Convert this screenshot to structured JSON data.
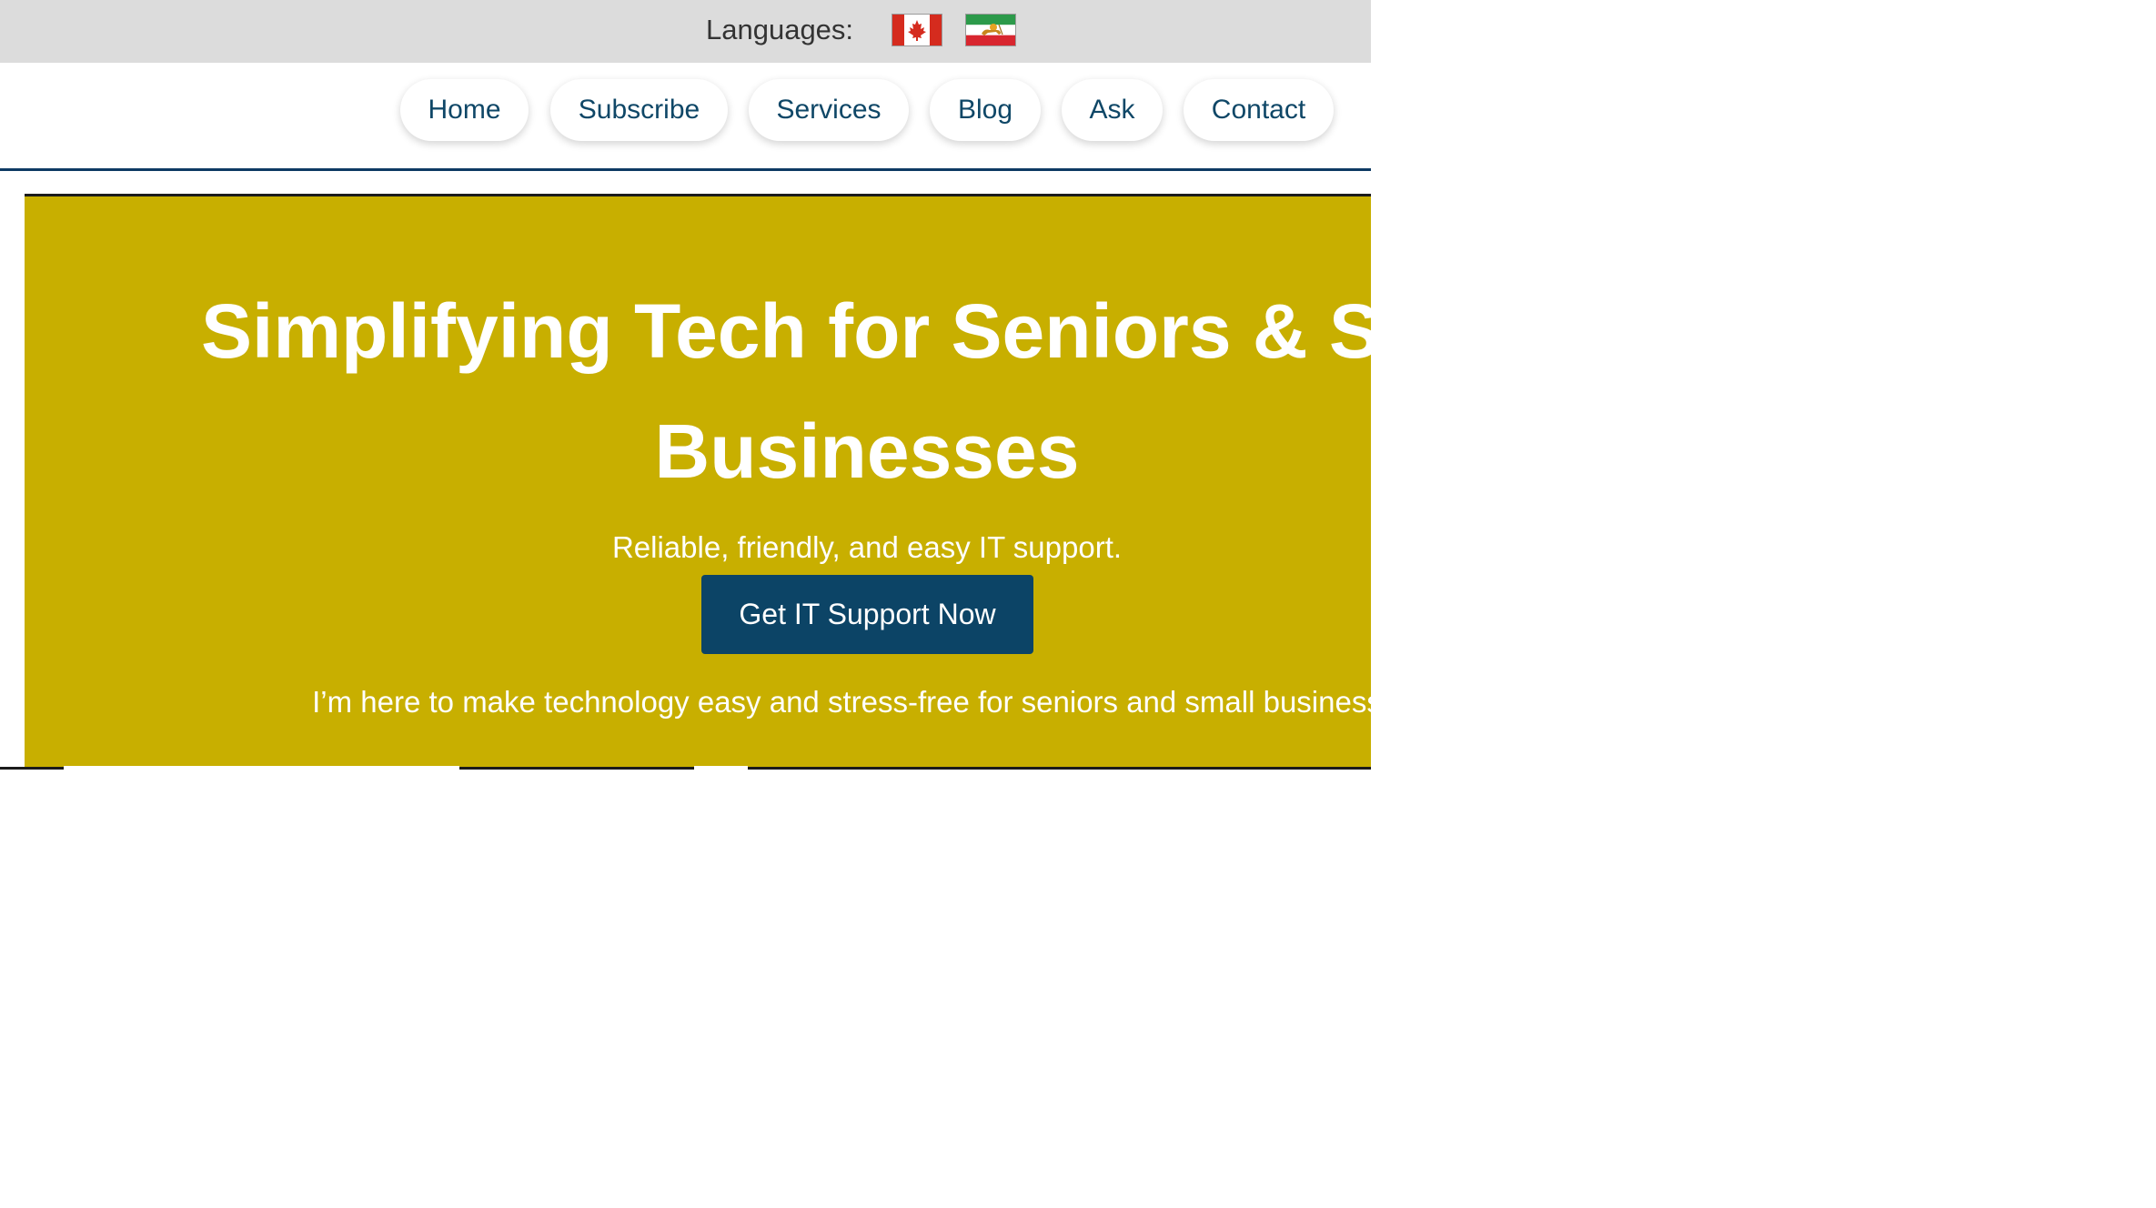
{
  "language_bar": {
    "label": "Languages:",
    "flags": [
      {
        "icon": "canada-flag-icon"
      },
      {
        "icon": "iran-lion-and-sun-flag-icon"
      }
    ]
  },
  "nav": {
    "items": [
      {
        "label": "Home"
      },
      {
        "label": "Subscribe"
      },
      {
        "label": "Services"
      },
      {
        "label": "Blog"
      },
      {
        "label": "Ask"
      },
      {
        "label": "Contact"
      }
    ]
  },
  "hero": {
    "title": "Simplifying Tech for Seniors & Small\nBusinesses",
    "subtitle": "Reliable, friendly, and easy IT support.",
    "cta_label": "Get IT Support Now",
    "body": "I’m here to make technology easy and stress-free for seniors and small businesses."
  },
  "colors": {
    "hero_background": "#c8af00",
    "cta_background": "#0c4466",
    "nav_text": "#0f4767",
    "nav_rule": "#0d3a63",
    "language_bar_background": "#dcdcdc"
  }
}
